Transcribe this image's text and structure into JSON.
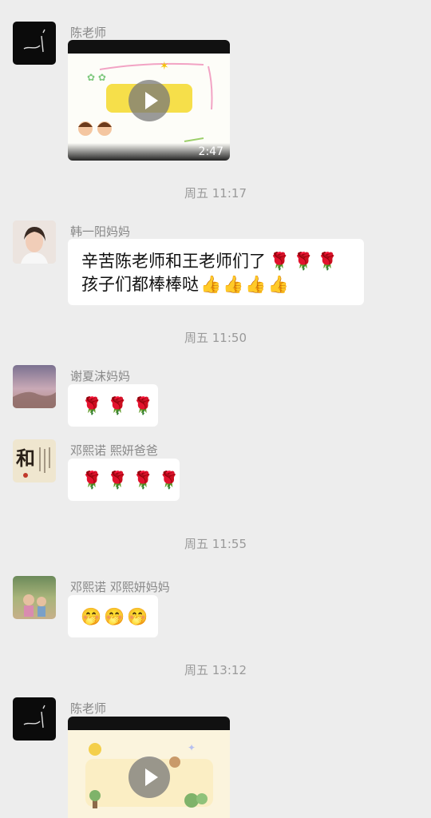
{
  "messages": [
    {
      "sender": "陈老师",
      "video_duration": "2:47"
    },
    {
      "sender": "韩一阳妈妈",
      "text_line1": "辛苦陈老师和王老师们了",
      "text_line2": "孩子们都棒棒哒"
    },
    {
      "sender": "谢夏沫妈妈"
    },
    {
      "sender": "邓熙诺 熙妍爸爸"
    },
    {
      "sender": "邓熙诺 邓熙妍妈妈"
    },
    {
      "sender": "陈老师"
    }
  ],
  "timestamps": [
    "周五 11:17",
    "周五 11:50",
    "周五 11:55",
    "周五 13:12"
  ],
  "avatar_texts": {
    "he_char": "和"
  },
  "colors": {
    "background": "#ededed",
    "bubble": "#ffffff",
    "tulip": "#d8262b",
    "stem": "#3e9b3a"
  }
}
